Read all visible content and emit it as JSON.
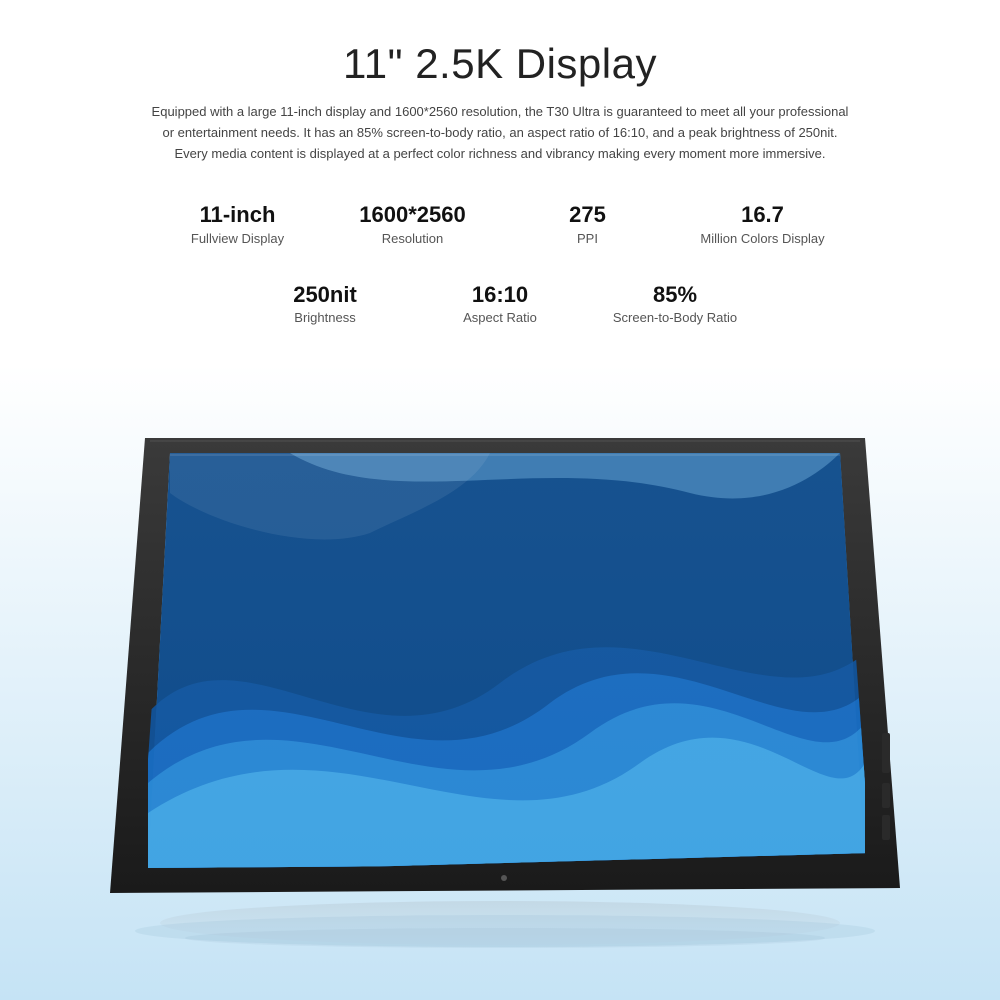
{
  "header": {
    "title": "11\" 2.5K Display",
    "description": "Equipped with a large 11-inch display and 1600*2560 resolution, the T30 Ultra is guaranteed to meet all your professional or entertainment needs. It has an 85% screen-to-body ratio, an aspect ratio of 16:10, and a peak brightness of 250nit. Every media content is displayed at a perfect color richness and vibrancy making every moment more immersive."
  },
  "specs_row1": [
    {
      "value": "11-inch",
      "label": "Fullview Display"
    },
    {
      "value": "1600*2560",
      "label": "Resolution"
    },
    {
      "value": "275",
      "label": "PPI"
    },
    {
      "value": "16.7",
      "label": "Million Colors Display"
    }
  ],
  "specs_row2": [
    {
      "value": "250nit",
      "label": "Brightness"
    },
    {
      "value": "16:10",
      "label": "Aspect Ratio"
    },
    {
      "value": "85%",
      "label": "Screen-to-Body Ratio"
    }
  ]
}
